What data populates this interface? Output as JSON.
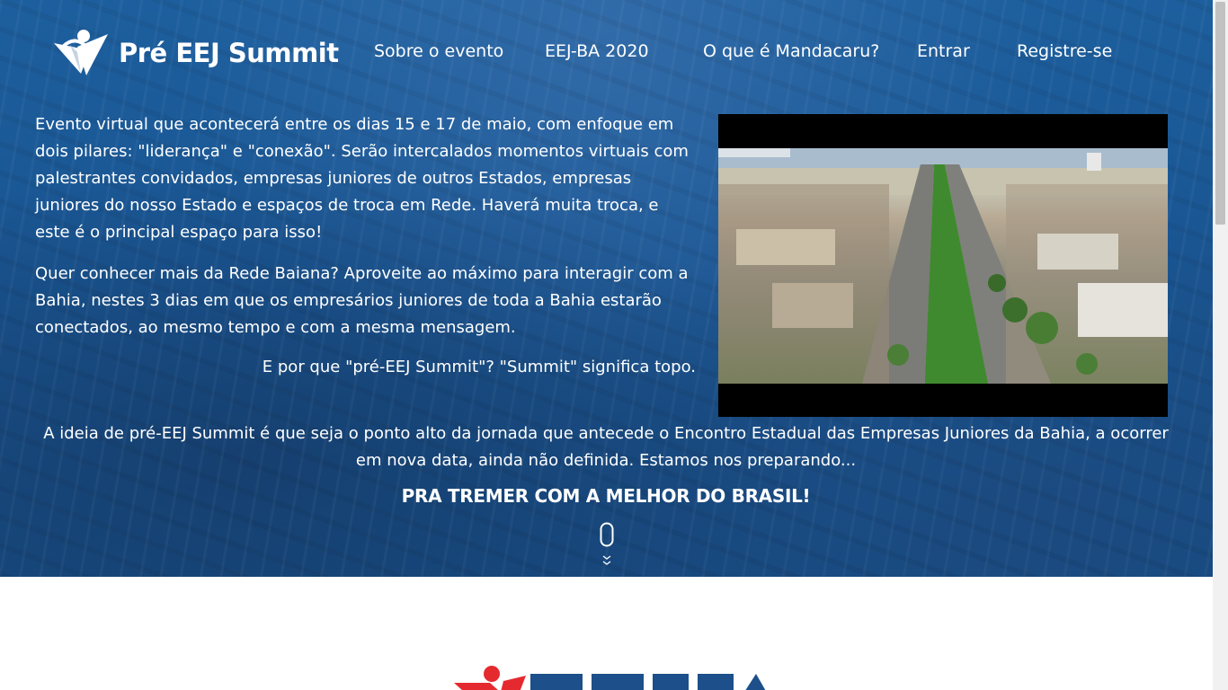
{
  "brand": {
    "name": "Pré EEJ Summit",
    "logo_icon": "summit-person-icon"
  },
  "nav": {
    "items": [
      {
        "label": "Sobre o evento"
      },
      {
        "label": "EEJ-BA 2020"
      },
      {
        "label": "O que é Mandacaru?"
      },
      {
        "label": "Entrar"
      },
      {
        "label": "Registre-se"
      }
    ]
  },
  "intro": {
    "paragraph1": "Evento virtual que acontecerá entre os dias 15 e 17 de maio, com enfoque em dois pilares: \"liderança\" e \"conexão\". Serão intercalados momentos virtuais com palestrantes convidados, empresas juniores de outros Estados, empresas juniores do nosso Estado e espaços de troca em Rede. Haverá muita troca, e este é o principal espaço para isso!",
    "paragraph2": "Quer conhecer mais da Rede Baiana? Aproveite ao máximo para interagir com a Bahia, nestes 3 dias em que os empresários juniores de toda a Bahia estarão conectados, ao mesmo tempo e com a mesma mensagem.",
    "paragraph3": "E por que \"pré-EEJ Summit\"? \"Summit\" significa topo."
  },
  "idea": "A ideia de pré-EEJ Summit é que seja o ponto alto da jornada que antecede o Encontro Estadual das Empresas Juniores da Bahia, a ocorrer em nova data, ainda não definida. Estamos nos preparando...",
  "tagline": "PRA TREMER COM A MELHOR DO BRASIL!",
  "colors": {
    "hero_blue": "#1a5693",
    "brand_red": "#e52a2f",
    "brand_navy": "#1d4f8a",
    "text": "#ffffff"
  },
  "icons": {
    "scroll": "mouse-scroll-icon",
    "chevrons": "chevron-down-icon"
  },
  "section2": {
    "logo_icon": "eejba-logo-icon"
  }
}
